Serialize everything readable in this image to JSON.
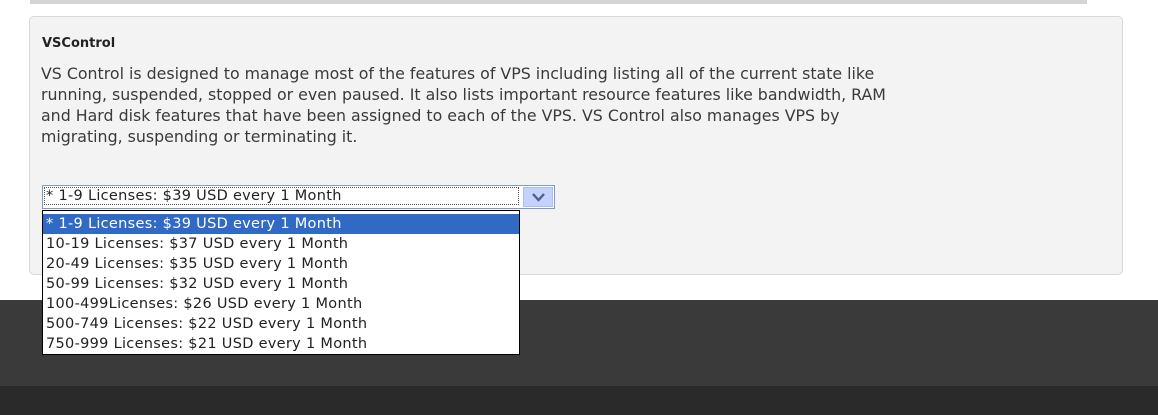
{
  "product": {
    "title": "VSControl",
    "description": "VS Control is designed to manage most of the features of VPS including listing all of the current state like running, suspended, stopped or even paused. It also lists important resource features like bandwidth, RAM and Hard disk features that have been assigned to each of the VPS. VS Control also manages VPS by migrating, suspending or terminating it."
  },
  "billing_select": {
    "selected_value": "* 1-9 Licenses: $39 USD every 1 Month",
    "arrow_icon": "chevron-down-icon",
    "options": [
      "* 1-9 Licenses: $39 USD every 1 Month",
      "10-19 Licenses: $37 USD every 1 Month",
      "20-49 Licenses: $35 USD every 1 Month",
      "50-99 Licenses: $32 USD every 1 Month",
      "100-499Licenses: $26 USD every 1 Month",
      "500-749 Licenses: $22 USD every 1 Month",
      "750-999 Licenses: $21 USD every 1 Month"
    ],
    "highlight_color": "#316ac5"
  },
  "colors": {
    "footer": "#3a3a3a",
    "footer_bottom": "#2a2a2a",
    "box_background": "#f3f3f3"
  }
}
